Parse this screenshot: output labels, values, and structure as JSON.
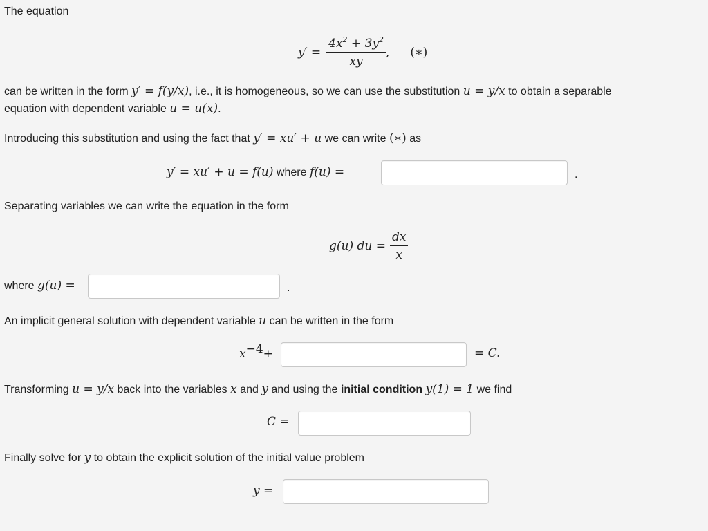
{
  "intro": {
    "text": "The equation"
  },
  "main_equation": {
    "lhs": "y′ =",
    "numerator_a": "4x",
    "exp_a": "2",
    "plus": " + 3y",
    "exp_b": "2",
    "denominator": "xy",
    "comma": ",",
    "tag": "(∗)"
  },
  "para1": {
    "l1_a": "can be written in the form ",
    "l1_m1": "y′ = f(y/x)",
    "l1_b": ", i.e., it is homogeneous, so we can use the substitution ",
    "l1_m2": "u = y/x",
    "l1_c": " to obtain a separable",
    "l2_a": "equation with dependent variable ",
    "l2_m": "u = u(x)",
    "l2_b": "."
  },
  "para2": {
    "a": "Introducing this substitution and using the fact that ",
    "m1": "y′ = xu′ + u",
    "b": " we can write ",
    "m2": "(∗)",
    "c": " as"
  },
  "eq_f": {
    "m1": "y′ = xu′ + u = f(u)",
    "where": " where ",
    "m2": "f(u) =",
    "period": ".",
    "input_value": ""
  },
  "para3": {
    "text": "Separating variables we can write the equation in the form"
  },
  "eq_g": {
    "lhs": "g(u) du =",
    "num": "dx",
    "den": "x"
  },
  "where_g": {
    "label": "where ",
    "m": "g(u) =",
    "period": ".",
    "input_value": ""
  },
  "para4": {
    "a": "An implicit general solution with dependent variable ",
    "m": "u",
    "b": " can be written in the form"
  },
  "eq_implicit": {
    "base": "x",
    "exp": "−4",
    "plus": "+",
    "rhs": "= C.",
    "input_value": ""
  },
  "para5": {
    "a": "Transforming ",
    "m1": "u = y/x",
    "b": " back into the variables ",
    "m2": "x",
    "c": " and ",
    "m3": "y",
    "d": " and using the ",
    "bold": "initial condition",
    "e": " ",
    "m4": "y(1) = 1",
    "f": " we find"
  },
  "eq_C": {
    "label": "C =",
    "input_value": ""
  },
  "para6": {
    "a": "Finally solve for ",
    "m": "y",
    "b": " to obtain the explicit solution of the initial value problem"
  },
  "eq_y": {
    "label": "y =",
    "input_value": ""
  }
}
